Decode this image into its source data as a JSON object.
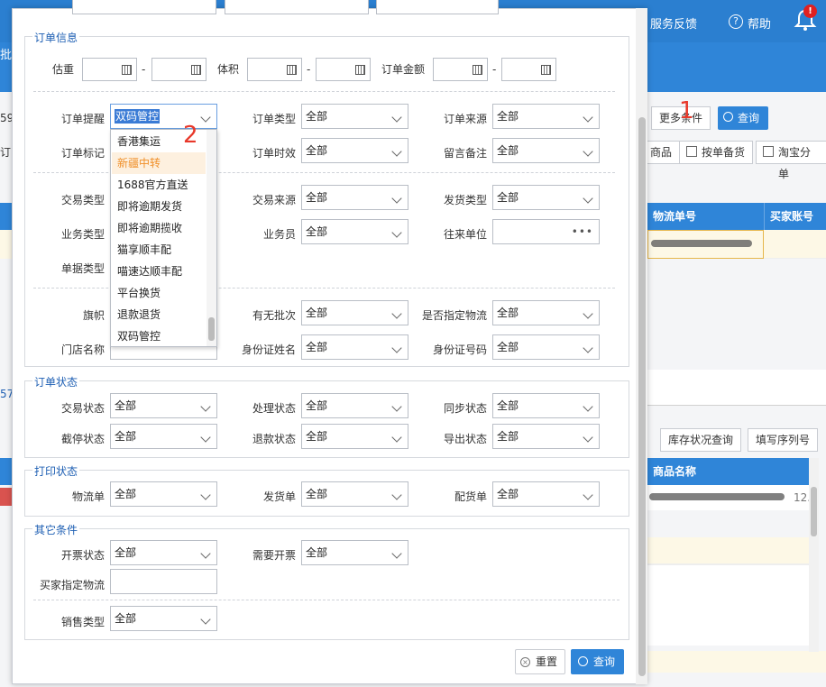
{
  "header": {
    "service_feedback": "服务反馈",
    "help": "帮助",
    "bell_badge": "!",
    "left_fragment": "批"
  },
  "background": {
    "more_conditions": "更多条件",
    "query": "查询",
    "left_num_1": "59",
    "left_frag_2": "订",
    "toolbar": [
      "商品",
      "按单备货",
      "淘宝分单"
    ],
    "grid_headers": [
      "物流单号",
      "买家账号"
    ],
    "left_num_2": "57",
    "lower_toolbar": [
      "库存状况查询",
      "填写序列号"
    ],
    "lower_header": "商品名称",
    "lower_row_suffix": "12.",
    "annotation_1": "1",
    "annotation_2": "2"
  },
  "modal": {
    "order_info": {
      "legend": "订单信息",
      "weight_label": "估重",
      "volume_label": "体积",
      "amount_label": "订单金额",
      "range_sep": "-",
      "fields": {
        "order_alert": {
          "label": "订单提醒",
          "value": "双码管控"
        },
        "order_type": {
          "label": "订单类型",
          "value": "全部"
        },
        "order_source": {
          "label": "订单来源",
          "value": "全部"
        },
        "order_mark": {
          "label": "订单标记"
        },
        "order_timeliness": {
          "label": "订单时效",
          "value": "全部"
        },
        "message_note": {
          "label": "留言备注",
          "value": "全部"
        },
        "trade_type": {
          "label": "交易类型"
        },
        "trade_source": {
          "label": "交易来源",
          "value": "全部"
        },
        "ship_type": {
          "label": "发货类型",
          "value": "全部"
        },
        "business_type": {
          "label": "业务类型"
        },
        "salesman": {
          "label": "业务员",
          "value": "全部"
        },
        "partner": {
          "label": "往来单位",
          "value": "•••"
        },
        "doc_type": {
          "label": "单据类型"
        },
        "flag": {
          "label": "旗帜"
        },
        "has_batch": {
          "label": "有无批次",
          "value": "全部"
        },
        "designated_logistics": {
          "label": "是否指定物流",
          "value": "全部"
        },
        "store_name": {
          "label": "门店名称"
        },
        "id_name": {
          "label": "身份证姓名",
          "value": "全部"
        },
        "id_number": {
          "label": "身份证号码",
          "value": "全部"
        }
      },
      "dropdown_options": [
        "香港集运",
        "新疆中转",
        "1688官方直送",
        "即将逾期发货",
        "即将逾期揽收",
        "猫享顺丰配",
        "喵速达顺丰配",
        "平台换货",
        "退款退货",
        "双码管控"
      ],
      "dropdown_hover_index": 1
    },
    "order_status": {
      "legend": "订单状态",
      "trade_status": {
        "label": "交易状态",
        "value": "全部"
      },
      "process_status": {
        "label": "处理状态",
        "value": "全部"
      },
      "sync_status": {
        "label": "同步状态",
        "value": "全部"
      },
      "intercept_status": {
        "label": "截停状态",
        "value": "全部"
      },
      "refund_status": {
        "label": "退款状态",
        "value": "全部"
      },
      "export_status": {
        "label": "导出状态",
        "value": "全部"
      }
    },
    "print_status": {
      "legend": "打印状态",
      "logistics_slip": {
        "label": "物流单",
        "value": "全部"
      },
      "delivery_slip": {
        "label": "发货单",
        "value": "全部"
      },
      "picking_slip": {
        "label": "配货单",
        "value": "全部"
      }
    },
    "other": {
      "legend": "其它条件",
      "invoice_status": {
        "label": "开票状态",
        "value": "全部"
      },
      "need_invoice": {
        "label": "需要开票",
        "value": "全部"
      },
      "buyer_logistics": {
        "label": "买家指定物流"
      },
      "sales_type": {
        "label": "销售类型",
        "value": "全部"
      }
    },
    "reset_button": "重置",
    "query_button": "查询"
  }
}
